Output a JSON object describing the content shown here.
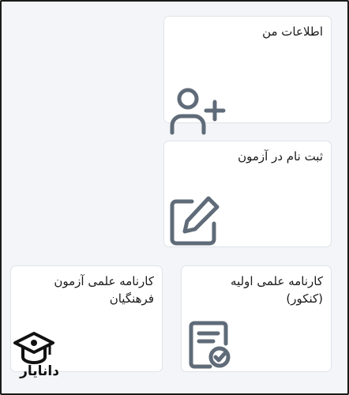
{
  "cards": {
    "my_info": {
      "title": "اطلاعات من",
      "icon": "add-user-icon"
    },
    "exam_registration": {
      "title": "ثبت نام در آزمون",
      "icon": "edit-icon"
    },
    "initial_report": {
      "title": "کارنامه علمی اولیه\n(کنکور)",
      "icon": "certificate-icon"
    },
    "farhangian_report": {
      "title": "کارنامه علمی آزمون\nفرهنگیان"
    }
  },
  "watermark": {
    "text": "دانایار",
    "icon": "graduation-cap-icon"
  },
  "colors": {
    "icon": "#5f6b78",
    "card_border": "#dfe3e9",
    "background": "#f3f5f8"
  }
}
